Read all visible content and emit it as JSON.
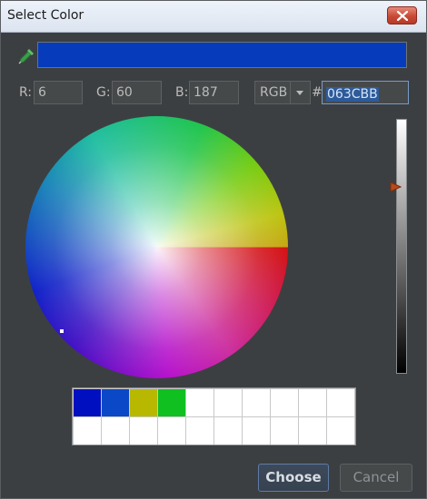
{
  "window": {
    "title": "Select Color"
  },
  "preview": {
    "color": "#063CBB"
  },
  "channels": {
    "r_label": "R:",
    "r_value": "6",
    "g_label": "G:",
    "g_value": "60",
    "b_label": "B:",
    "b_value": "187"
  },
  "mode": {
    "selected": "RGB"
  },
  "hex": {
    "prefix": "#",
    "value": "063CBB"
  },
  "swatches": [
    "#0010c0",
    "#0a48c8",
    "#b8b800",
    "#10c020",
    "#ffffff",
    "#ffffff",
    "#ffffff",
    "#ffffff",
    "#ffffff",
    "#ffffff",
    "#ffffff",
    "#ffffff",
    "#ffffff",
    "#ffffff",
    "#ffffff",
    "#ffffff",
    "#ffffff",
    "#ffffff",
    "#ffffff",
    "#ffffff"
  ],
  "buttons": {
    "choose": "Choose",
    "cancel": "Cancel"
  }
}
